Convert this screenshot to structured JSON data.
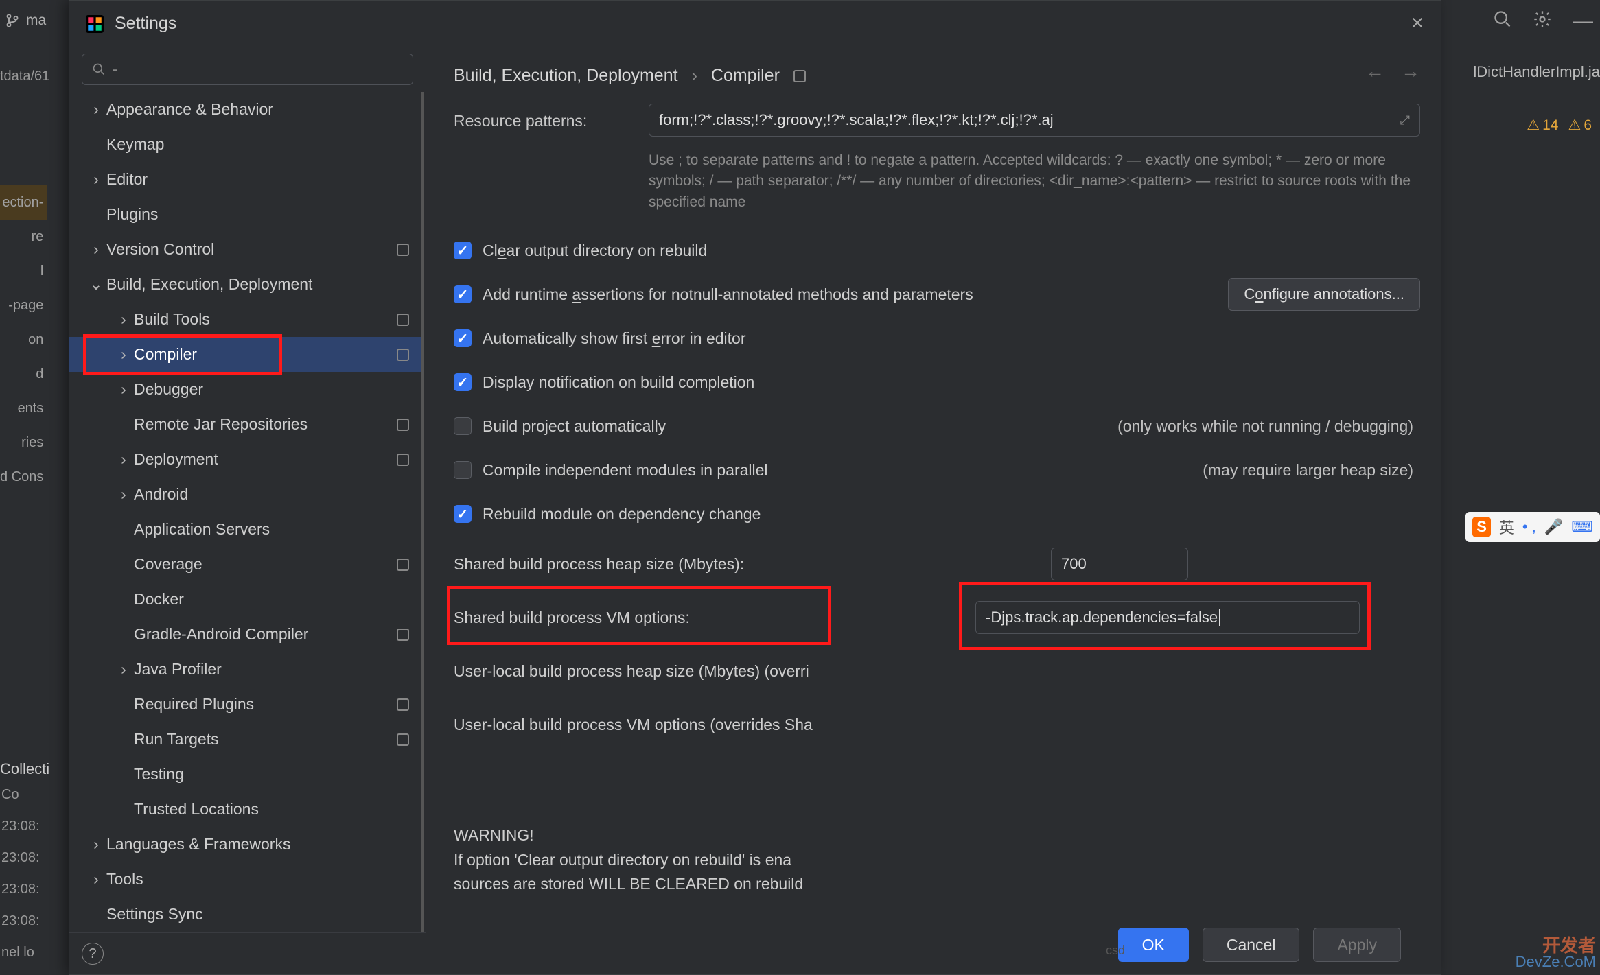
{
  "bg": {
    "branch_prefix": "ma",
    "tab_right": "lDictHandlerImpl.ja",
    "warn1": "14",
    "warn2": "6",
    "left_items": [
      "ection-",
      "",
      "re",
      "l",
      "-page",
      "on",
      "",
      "",
      "d",
      "ents",
      "ries",
      "d Cons"
    ],
    "left_label": "tdata/61",
    "collections": "Collecti",
    "term_lines": [
      "    Co",
      "23:08:",
      "23:08:",
      "23:08:",
      "23:08:",
      "nel lo"
    ],
    "ime_lang": "英",
    "watermark_top": "开发者",
    "watermark_bottom": "DevZe.CoM"
  },
  "dialog": {
    "title": "Settings",
    "search_placeholder": "",
    "breadcrumb": [
      "Build, Execution, Deployment",
      "Compiler"
    ],
    "nav_back": "←",
    "nav_fwd": "→"
  },
  "tree": [
    {
      "label": "Appearance & Behavior",
      "chev": ">",
      "lvl": 0
    },
    {
      "label": "Keymap",
      "chev": "",
      "lvl": 0
    },
    {
      "label": "Editor",
      "chev": ">",
      "lvl": 0
    },
    {
      "label": "Plugins",
      "chev": "",
      "lvl": 0
    },
    {
      "label": "Version Control",
      "chev": ">",
      "lvl": 0,
      "badge": true
    },
    {
      "label": "Build, Execution, Deployment",
      "chev": "v",
      "lvl": 0
    },
    {
      "label": "Build Tools",
      "chev": ">",
      "lvl": 1,
      "badge": true
    },
    {
      "label": "Compiler",
      "chev": ">",
      "lvl": 1,
      "badge": true,
      "selected": true,
      "highlight": true
    },
    {
      "label": "Debugger",
      "chev": ">",
      "lvl": 1
    },
    {
      "label": "Remote Jar Repositories",
      "chev": "",
      "lvl": 1,
      "badge": true
    },
    {
      "label": "Deployment",
      "chev": ">",
      "lvl": 1,
      "badge": true
    },
    {
      "label": "Android",
      "chev": ">",
      "lvl": 1
    },
    {
      "label": "Application Servers",
      "chev": "",
      "lvl": 1
    },
    {
      "label": "Coverage",
      "chev": "",
      "lvl": 1,
      "badge": true
    },
    {
      "label": "Docker",
      "chev": "",
      "lvl": 1
    },
    {
      "label": "Gradle-Android Compiler",
      "chev": "",
      "lvl": 1,
      "badge": true
    },
    {
      "label": "Java Profiler",
      "chev": ">",
      "lvl": 1
    },
    {
      "label": "Required Plugins",
      "chev": "",
      "lvl": 1,
      "badge": true
    },
    {
      "label": "Run Targets",
      "chev": "",
      "lvl": 1,
      "badge": true
    },
    {
      "label": "Testing",
      "chev": "",
      "lvl": 1
    },
    {
      "label": "Trusted Locations",
      "chev": "",
      "lvl": 1
    },
    {
      "label": "Languages & Frameworks",
      "chev": ">",
      "lvl": 0
    },
    {
      "label": "Tools",
      "chev": ">",
      "lvl": 0
    },
    {
      "label": "Settings Sync",
      "chev": "",
      "lvl": 0
    }
  ],
  "compiler": {
    "resource_patterns_label": "Resource patterns:",
    "resource_patterns_value": "form;!?*.class;!?*.groovy;!?*.scala;!?*.flex;!?*.kt;!?*.clj;!?*.aj",
    "resource_hint": "Use ; to separate patterns and ! to negate a pattern. Accepted wildcards: ? — exactly one symbol; * — zero or more symbols; / — path separator; /**/ — any number of directories; <dir_name>:<pattern> — restrict to source roots with the specified name",
    "chk_clear": {
      "pre": "Cl",
      "u": "e",
      "post": "ar output directory on rebuild",
      "on": true
    },
    "chk_assert": {
      "pre": "Add runtime ",
      "u": "a",
      "post": "ssertions for notnull-annotated methods and parameters",
      "on": true,
      "btn_pre": "C",
      "btn_u": "o",
      "btn_post": "nfigure annotations..."
    },
    "chk_firsterr": {
      "pre": "Automatically show first ",
      "u": "e",
      "post": "rror in editor",
      "on": true
    },
    "chk_notify": {
      "pre": "Display notification on build completion",
      "u": "",
      "post": "",
      "on": true
    },
    "chk_auto": {
      "pre": "Build project automatically",
      "on": false,
      "side": "(only works while not running / debugging)"
    },
    "chk_parallel": {
      "pre": "Compile independent modules in parallel",
      "on": false,
      "side": "(may require larger heap size)"
    },
    "chk_rebuild": {
      "pre": "Rebuild module on dependency change",
      "on": true
    },
    "heap_label": "Shared build process heap size (Mbytes):",
    "heap_value": "700",
    "vm_label": "Shared build process VM options:",
    "vm_value": "-Djps.track.ap.dependencies=false",
    "local_heap": "User-local build process heap size (Mbytes) (overri",
    "local_vm": "User-local build process VM options (overrides Sha",
    "warning_title": "WARNING!",
    "warning_l1": "If option 'Clear output directory on rebuild' is ena",
    "warning_l2": "sources are stored WILL BE CLEARED on rebuild"
  },
  "footer": {
    "ok": "OK",
    "cancel": "Cancel",
    "apply": "Apply",
    "csdn": "csd"
  }
}
